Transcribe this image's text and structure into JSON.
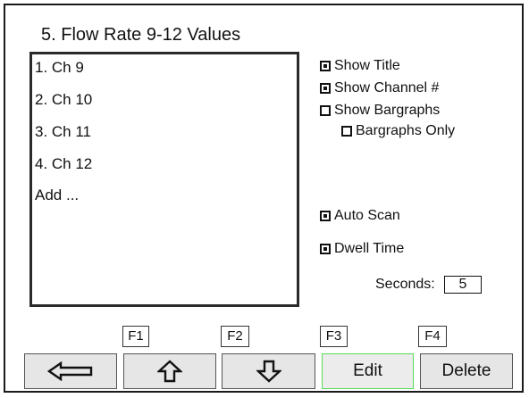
{
  "screen": {
    "title": "5. Flow Rate 9-12 Values"
  },
  "channel_list": {
    "items": [
      "1. Ch 9",
      "2. Ch 10",
      "3. Ch 11",
      "4. Ch 12",
      "Add ..."
    ]
  },
  "options": {
    "show_title": {
      "label": "Show Title",
      "checked": true
    },
    "show_channel": {
      "label": "Show Channel #",
      "checked": true
    },
    "show_bargraphs": {
      "label": "Show Bargraphs",
      "checked": false
    },
    "bargraphs_only": {
      "label": "Bargraphs Only",
      "checked": false
    },
    "auto_scan": {
      "label": "Auto Scan",
      "checked": true
    },
    "dwell_time": {
      "label": "Dwell Time",
      "checked": true
    }
  },
  "dwell": {
    "seconds_label": "Seconds:",
    "seconds_value": "5"
  },
  "function_keys": [
    "F1",
    "F2",
    "F3",
    "F4"
  ],
  "buttons": {
    "back_icon": "left-arrow-icon",
    "up_icon": "up-arrow-icon",
    "down_icon": "down-arrow-icon",
    "edit_label": "Edit",
    "delete_label": "Delete"
  },
  "colors": {
    "selected_button_border": "#55dd55"
  }
}
